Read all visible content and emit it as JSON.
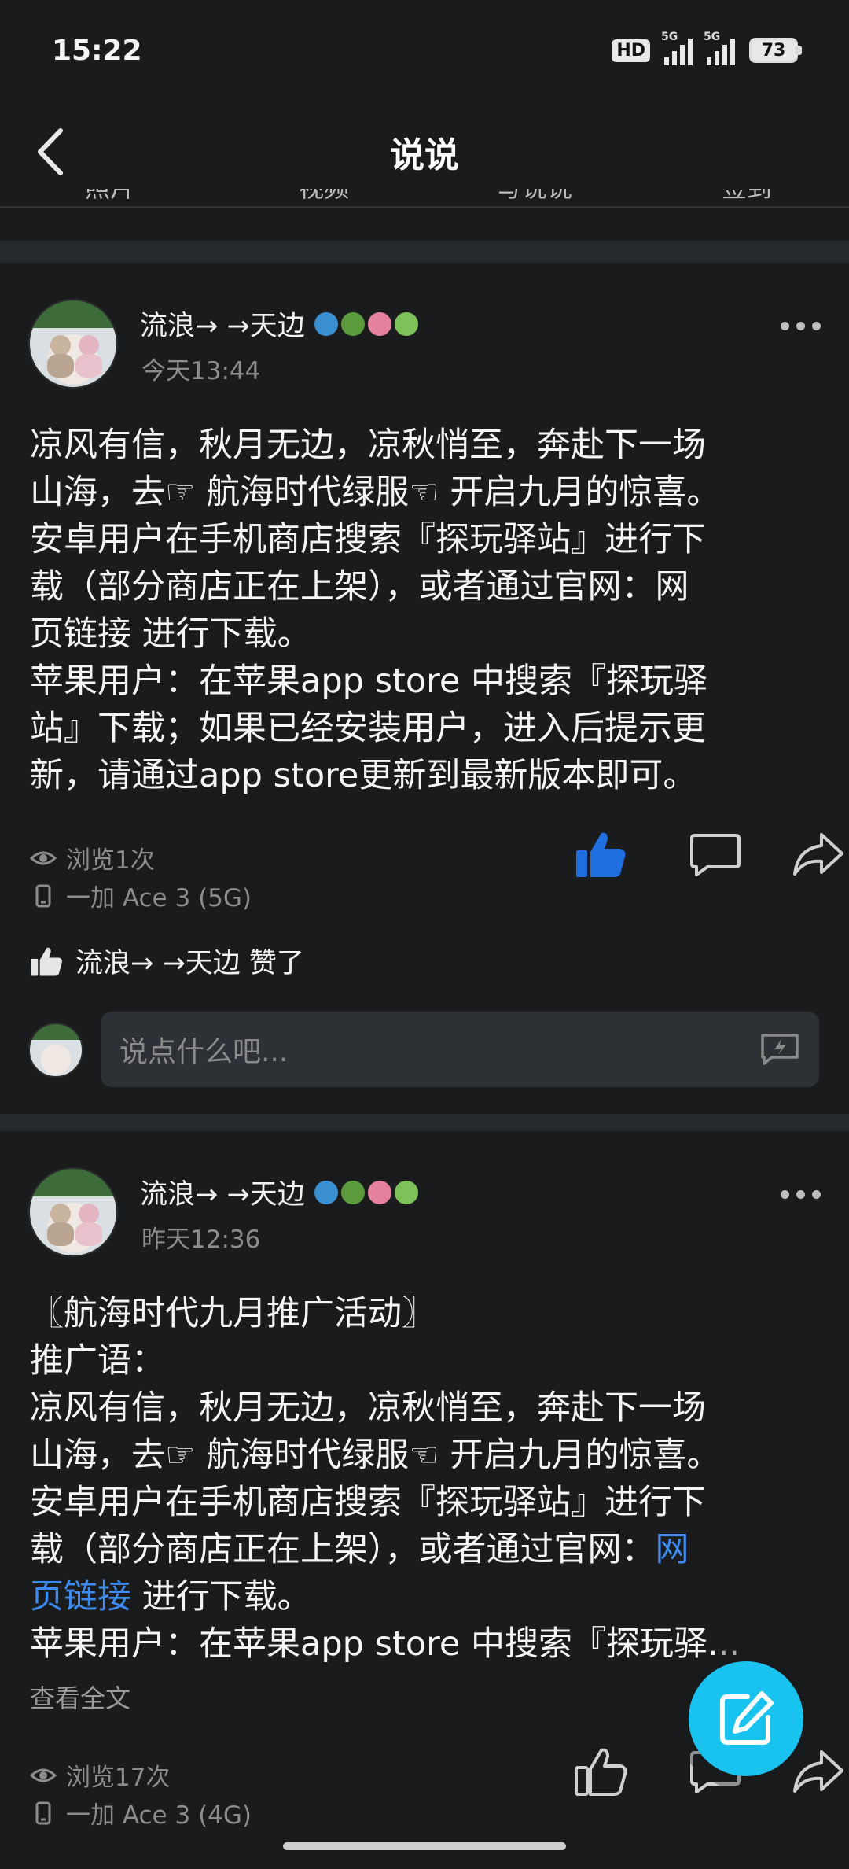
{
  "status_bar": {
    "time": "15:22",
    "battery": "73",
    "hd": "HD",
    "network_1": "5G",
    "network_2": "5G"
  },
  "header": {
    "title": "说说"
  },
  "tabs": [
    "照片",
    "视频",
    "写说说",
    "签到"
  ],
  "posts": [
    {
      "author": "流浪→ →天边",
      "time": "今天13:44",
      "content_lines": [
        "凉风有信，秋月无边，凉秋悄至，奔赴下一场",
        "山海，去☞ 航海时代绿服☜ 开启九月的惊喜。",
        "安卓用户在手机商店搜索『探玩驿站』进行下",
        "载（部分商店正在上架），或者通过官网：网",
        "页链接 进行下载。",
        "苹果用户：在苹果app store 中搜索『探玩驿",
        "站』下载；如果已经安装用户，进入后提示更",
        "新，请通过app store更新到最新版本即可。"
      ],
      "views": "浏览1次",
      "device": "一加 Ace 3 (5G)",
      "liked_by": "流浪→ →天边 赞了",
      "comment_placeholder": "说点什么吧..."
    },
    {
      "author": "流浪→ →天边",
      "time": "昨天12:36",
      "content_lines": [
        "〖航海时代九月推广活动〗",
        "推广语：",
        "凉风有信，秋月无边，凉秋悄至，奔赴下一场",
        "山海，去☞ 航海时代绿服☜ 开启九月的惊喜。",
        "安卓用户在手机商店搜索『探玩驿站』进行下"
      ],
      "line6_text": "载（部分商店正在上架），或者通过官网：",
      "line6_link": "网",
      "line7_link": "页链接",
      "line7_text": " 进行下载。",
      "line8": "苹果用户：在苹果app store 中搜索『探玩驿...",
      "read_more": "查看全文",
      "views": "浏览17次",
      "device": "一加 Ace 3 (4G)"
    }
  ],
  "colors": {
    "background": "#1a1b1d",
    "like_active": "#1f6fe0",
    "link": "#3d8bf0",
    "fab": "#19c3f0"
  },
  "icons": [
    "back-arrow-icon",
    "more-dots-icon",
    "eye-icon",
    "phone-icon",
    "like-icon",
    "comment-icon",
    "share-icon",
    "emoji-keyboard-icon",
    "edit-icon"
  ]
}
